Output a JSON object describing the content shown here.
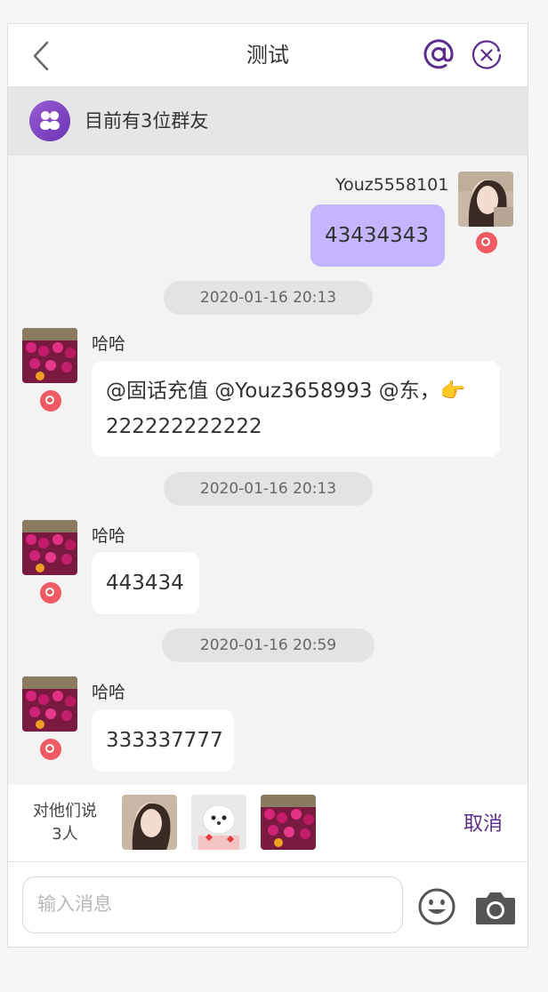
{
  "header": {
    "title": "测试"
  },
  "group": {
    "count_text": "目前有3位群友"
  },
  "messages": [
    {
      "sender": "Youz5558101",
      "text": "43434343"
    },
    {
      "time": "2020-01-16 20:13",
      "sender": "哈哈",
      "line1": "@固话充值 @Youz3658993 @东，👉",
      "line2": "222222222222"
    },
    {
      "time": "2020-01-16 20:13",
      "sender": "哈哈",
      "text": "443434"
    },
    {
      "time": "2020-01-16 20:59",
      "sender": "哈哈",
      "text": "333337777"
    }
  ],
  "mention": {
    "label_line1": "对他们说",
    "label_line2": "3人",
    "cancel_label": "取消"
  },
  "input": {
    "placeholder": "输入消息"
  },
  "colors": {
    "accent": "#5a2d8a",
    "my_bubble": "#c5b5ff",
    "badge": "#f05a62"
  },
  "icons": [
    "back-chevron-icon",
    "at-mention-icon",
    "close-circle-icon",
    "group-members-icon",
    "emoji-icon",
    "camera-icon"
  ]
}
